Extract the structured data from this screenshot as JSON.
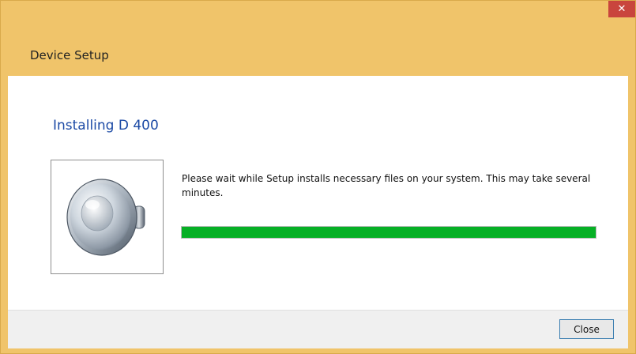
{
  "window": {
    "title": "Device Setup",
    "close_glyph": "✕",
    "frame_color": "#f0c46a"
  },
  "main": {
    "heading": "Installing D 400",
    "icon": "speaker-icon",
    "message": "Please wait while Setup installs necessary files on your system. This may take several minutes.",
    "progress_percent": 100,
    "progress_color": "#06b025"
  },
  "footer": {
    "close_label": "Close"
  }
}
